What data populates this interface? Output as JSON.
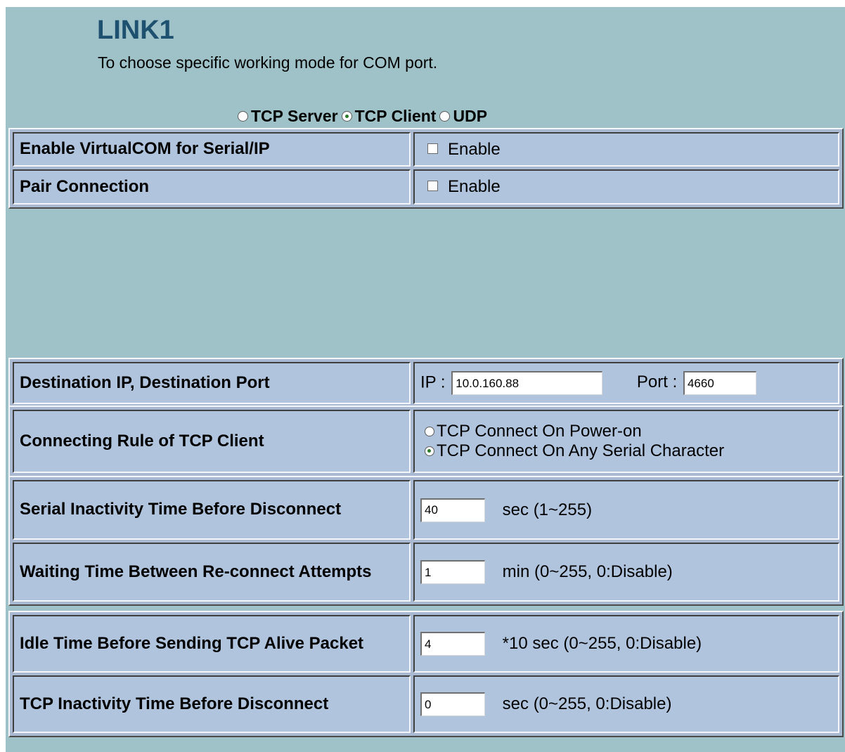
{
  "header": {
    "title": "LINK1",
    "subtitle": "To choose specific working mode for COM port."
  },
  "mode": {
    "options": [
      "TCP Server",
      "TCP Client",
      "UDP"
    ],
    "selected": "TCP Client"
  },
  "basic": {
    "virtualcom": {
      "label": "Enable VirtualCOM for Serial/IP",
      "checkbox_label": "Enable",
      "checked": false
    },
    "pair": {
      "label": "Pair Connection",
      "checkbox_label": "Enable",
      "checked": false
    }
  },
  "client": {
    "destination": {
      "label": "Destination IP, Destination Port",
      "ip_label": "IP :",
      "ip_value": "10.0.160.88",
      "port_label": "Port :",
      "port_value": "4660"
    },
    "connecting_rule": {
      "label": "Connecting Rule of TCP Client",
      "options": [
        "TCP Connect On Power-on",
        "TCP Connect On Any Serial Character"
      ],
      "selected": "TCP Connect On Any Serial Character"
    },
    "serial_inactivity": {
      "label": "Serial Inactivity Time Before Disconnect",
      "value": "40",
      "unit": "sec (1~255)"
    },
    "reconnect_wait": {
      "label": "Waiting Time Between Re-connect Attempts",
      "value": "1",
      "unit": "min (0~255, 0:Disable)"
    },
    "idle_alive": {
      "label": "Idle Time Before Sending TCP Alive Packet",
      "value": "4",
      "unit": "*10 sec (0~255, 0:Disable)"
    },
    "tcp_inactivity": {
      "label": "TCP Inactivity Time Before Disconnect",
      "value": "0",
      "unit": "sec (0~255, 0:Disable)"
    }
  },
  "colors": {
    "page_background": "#9ec2c8",
    "cell_background": "#b0c4de",
    "title": "#1e5070"
  }
}
